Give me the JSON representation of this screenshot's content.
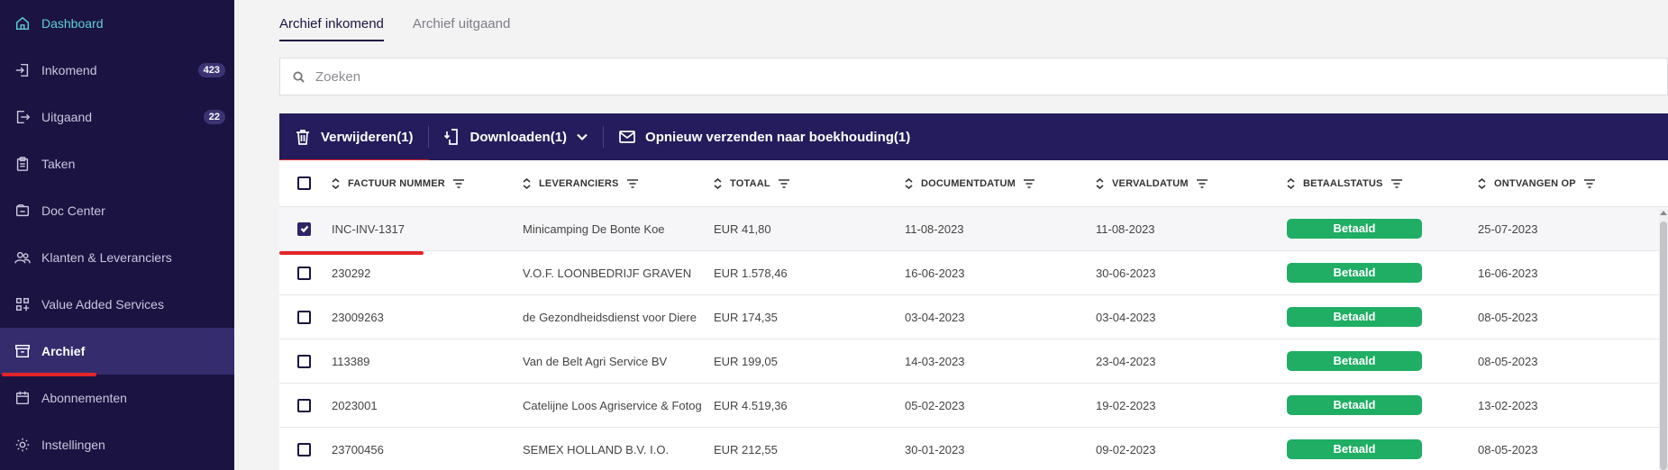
{
  "sidebar": {
    "items": [
      {
        "label": "Dashboard",
        "icon": "home-icon"
      },
      {
        "label": "Inkomend",
        "icon": "sign-in-icon",
        "badge": "423"
      },
      {
        "label": "Uitgaand",
        "icon": "sign-out-icon",
        "badge": "22"
      },
      {
        "label": "Taken",
        "icon": "clipboard-icon"
      },
      {
        "label": "Doc Center",
        "icon": "doc-center-icon"
      },
      {
        "label": "Klanten & Leveranciers",
        "icon": "users-icon"
      },
      {
        "label": "Value Added Services",
        "icon": "grid-plus-icon"
      },
      {
        "label": "Archief",
        "icon": "archive-icon"
      },
      {
        "label": "Abonnementen",
        "icon": "calendar-icon"
      },
      {
        "label": "Instellingen",
        "icon": "gear-icon"
      }
    ]
  },
  "tabs": [
    {
      "label": "Archief inkomend"
    },
    {
      "label": "Archief uitgaand"
    }
  ],
  "search": {
    "placeholder": "Zoeken"
  },
  "toolbar": {
    "delete_label": "Verwijderen(1)",
    "download_label": "Downloaden(1)",
    "resend_label": "Opnieuw verzenden naar boekhouding(1)"
  },
  "table": {
    "columns": [
      "FACTUUR NUMMER",
      "LEVERANCIERS",
      "TOTAAL",
      "DOCUMENTDATUM",
      "VERVALDATUM",
      "BETAALSTATUS",
      "ONTVANGEN OP"
    ],
    "rows": [
      {
        "invoice": "INC-INV-1317",
        "supplier": "Minicamping De Bonte Koe",
        "total": "EUR 41,80",
        "doc_date": "11-08-2023",
        "due_date": "11-08-2023",
        "status": "Betaald",
        "received": "25-07-2023",
        "checked": true
      },
      {
        "invoice": "230292",
        "supplier": "V.O.F. LOONBEDRIJF GRAVEN",
        "total": "EUR 1.578,46",
        "doc_date": "16-06-2023",
        "due_date": "30-06-2023",
        "status": "Betaald",
        "received": "16-06-2023",
        "checked": false
      },
      {
        "invoice": "23009263",
        "supplier": "de Gezondheidsdienst voor Diere",
        "total": "EUR 174,35",
        "doc_date": "03-04-2023",
        "due_date": "03-04-2023",
        "status": "Betaald",
        "received": "08-05-2023",
        "checked": false
      },
      {
        "invoice": "113389",
        "supplier": "Van de Belt Agri Service BV",
        "total": "EUR 199,05",
        "doc_date": "14-03-2023",
        "due_date": "23-04-2023",
        "status": "Betaald",
        "received": "08-05-2023",
        "checked": false
      },
      {
        "invoice": "2023001",
        "supplier": "Catelijne Loos Agriservice & Fotog",
        "total": "EUR 4.519,36",
        "doc_date": "05-02-2023",
        "due_date": "19-02-2023",
        "status": "Betaald",
        "received": "13-02-2023",
        "checked": false
      },
      {
        "invoice": "23700456",
        "supplier": "SEMEX HOLLAND B.V. I.O.",
        "total": "EUR 212,55",
        "doc_date": "30-01-2023",
        "due_date": "09-02-2023",
        "status": "Betaald",
        "received": "08-05-2023",
        "checked": false
      }
    ]
  },
  "colors": {
    "sidebar_bg": "#1b1442",
    "toolbar_bg": "#241c5c",
    "status_green": "#1fae64",
    "highlight_red": "#e32528",
    "dashboard_accent": "#5fd0d6"
  }
}
